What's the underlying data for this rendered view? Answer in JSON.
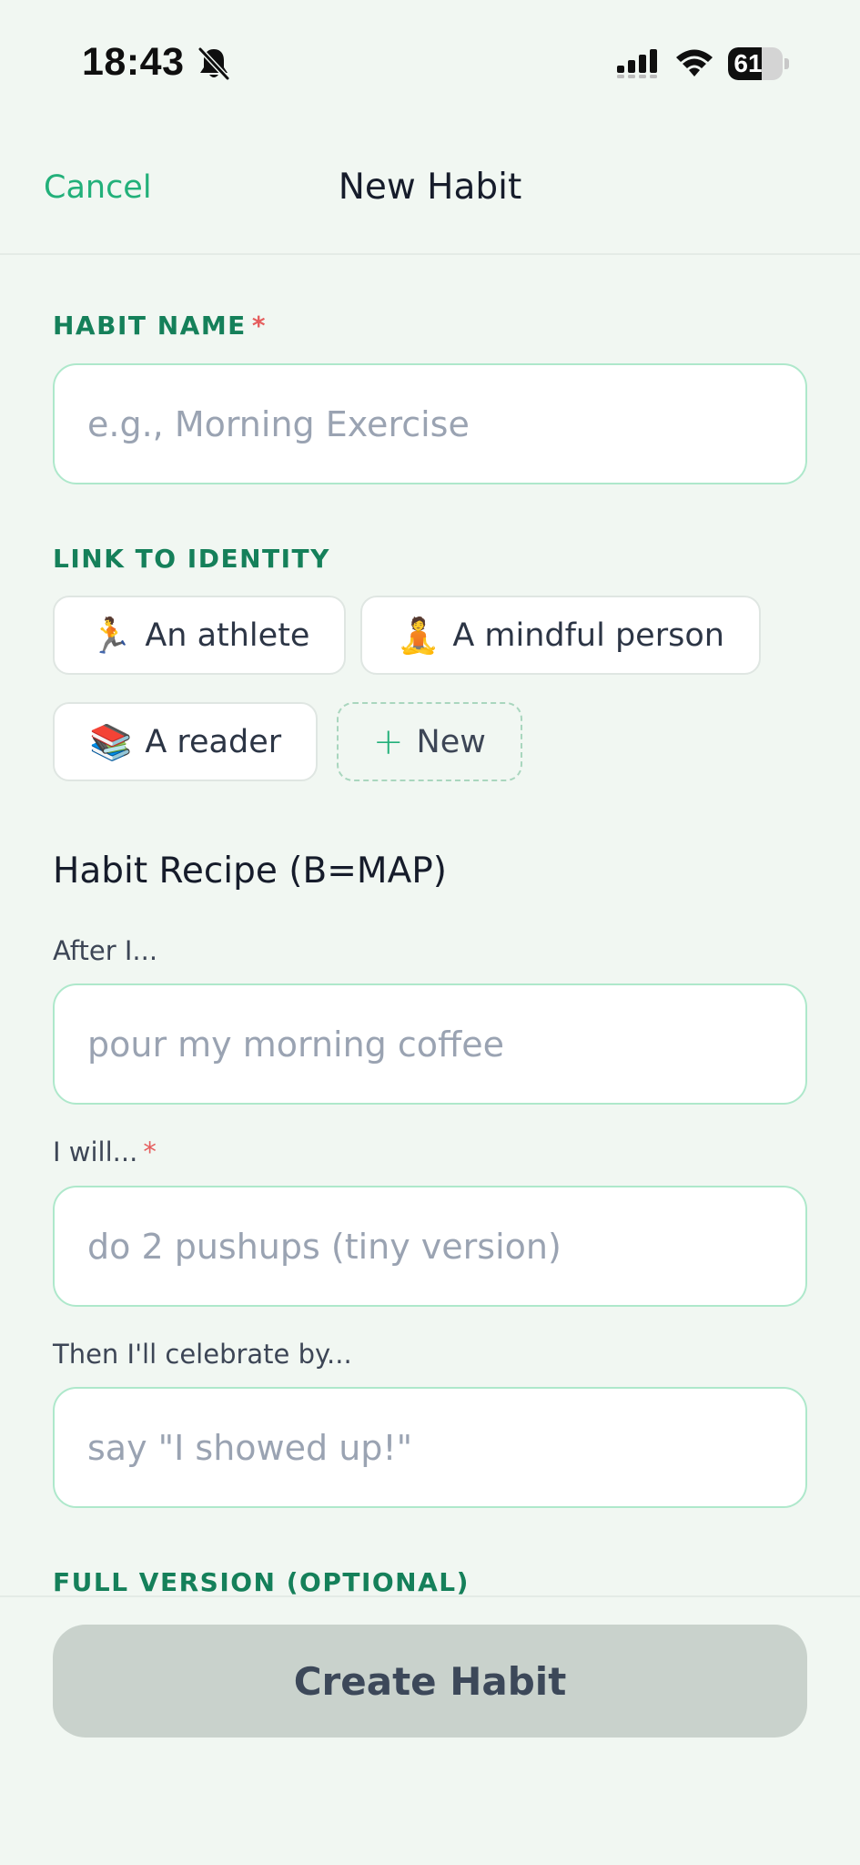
{
  "status_bar": {
    "time": "18:43",
    "battery": "61",
    "battery_level": 0.61
  },
  "nav": {
    "cancel_label": "Cancel",
    "title": "New Habit"
  },
  "habit_name": {
    "label": "HABIT NAME",
    "required_mark": "*",
    "placeholder": "e.g., Morning Exercise"
  },
  "identity": {
    "label": "LINK TO IDENTITY",
    "chips": [
      {
        "emoji": "🏃",
        "label": "An athlete"
      },
      {
        "emoji": "🧘",
        "label": "A mindful person"
      },
      {
        "emoji": "📚",
        "label": "A reader"
      }
    ],
    "new_plus": "+",
    "new_label": "New"
  },
  "recipe": {
    "title": "Habit Recipe (B=MAP)",
    "after": {
      "label": "After I...",
      "placeholder": "pour my morning coffee"
    },
    "will": {
      "label": "I will...",
      "required_mark": "*",
      "placeholder": "do 2 pushups (tiny version)"
    },
    "celebrate": {
      "label": "Then I'll celebrate by...",
      "placeholder": "say \"I showed up!\""
    }
  },
  "full_version": {
    "label": "FULL VERSION (OPTIONAL)"
  },
  "actions": {
    "create_label": "Create Habit"
  },
  "colors": {
    "accent": "#22b07a",
    "section_label": "#15805a",
    "required": "#e55d5d",
    "background": "#f1f7f2",
    "input_border": "#aee8cb",
    "button_disabled": "#c9d2cc"
  }
}
